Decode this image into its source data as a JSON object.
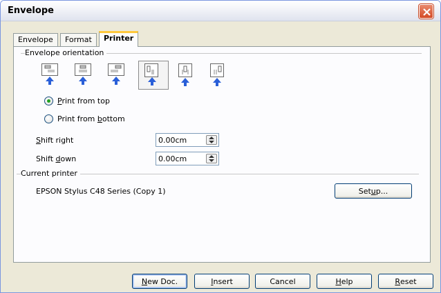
{
  "window": {
    "title": "Envelope"
  },
  "tabs": [
    {
      "label": "Envelope",
      "active": false
    },
    {
      "label": "Format",
      "active": false
    },
    {
      "label": "Printer",
      "active": true
    }
  ],
  "orientation": {
    "group_label": "Envelope orientation",
    "options": [
      {
        "icon": "envelope-horizontal-left-icon",
        "selected": false
      },
      {
        "icon": "envelope-horizontal-center-icon",
        "selected": false
      },
      {
        "icon": "envelope-horizontal-right-icon",
        "selected": false
      },
      {
        "icon": "envelope-vertical-left-icon",
        "selected": true
      },
      {
        "icon": "envelope-vertical-center-icon",
        "selected": false
      },
      {
        "icon": "envelope-vertical-right-icon",
        "selected": false
      }
    ],
    "print_from_top": {
      "pre": "",
      "key": "P",
      "post": "rint from top",
      "checked": true
    },
    "print_from_bottom": {
      "pre": "Print from ",
      "key": "b",
      "post": "ottom",
      "checked": false
    }
  },
  "shift": {
    "right": {
      "key": "S",
      "label_rest": "hift right",
      "value": "0.00cm"
    },
    "down": {
      "pre": "Shift ",
      "key": "d",
      "post": "own",
      "value": "0.00cm"
    }
  },
  "printer": {
    "group_label": "Current printer",
    "name": "EPSON Stylus C48 Series (Copy 1)",
    "setup": {
      "pre": "Set",
      "key": "u",
      "post": "p..."
    }
  },
  "buttons": {
    "new_doc": {
      "key": "N",
      "post": "ew Doc."
    },
    "insert": {
      "key": "I",
      "post": "nsert"
    },
    "cancel": {
      "label": "Cancel"
    },
    "help": {
      "key": "H",
      "post": "elp"
    },
    "reset": {
      "key": "R",
      "post": "eset"
    }
  },
  "colors": {
    "accent": "#FFC83C",
    "selected_radio": "#21A121",
    "arrow": "#2A5FD8"
  }
}
